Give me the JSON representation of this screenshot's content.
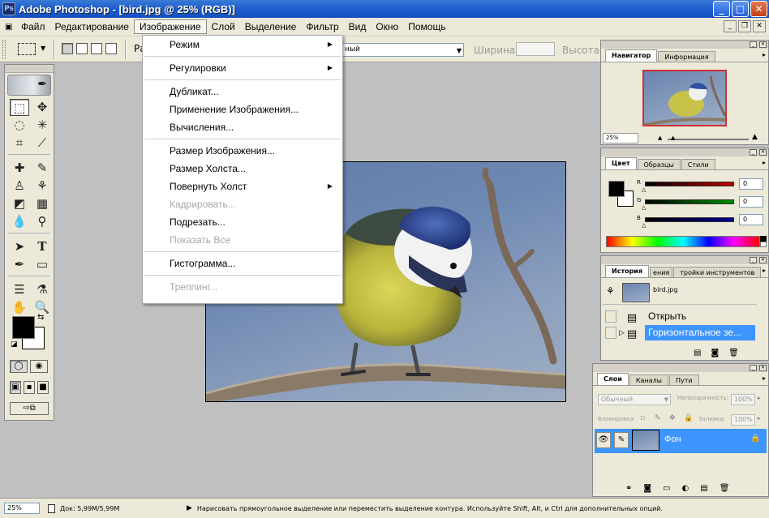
{
  "window": {
    "title": "Adobe Photoshop - [bird.jpg @ 25% (RGB)]",
    "minimize": "_",
    "maximize": "□",
    "close": "✕"
  },
  "mdi_buttons": {
    "minimize": "_",
    "restore": "❐",
    "close": "✕"
  },
  "menubar": {
    "items": [
      "Файл",
      "Редактирование",
      "Изображение",
      "Слой",
      "Выделение",
      "Фильтр",
      "Вид",
      "Окно",
      "Помощь"
    ],
    "active_index": 2
  },
  "options_bar": {
    "feather_prefix": "Ра",
    "style_value": "ный",
    "width_label": "Ширина:",
    "height_label": "Высота:"
  },
  "image_menu": {
    "groups": [
      [
        {
          "label": "Режим",
          "submenu": true,
          "disabled": false
        }
      ],
      [
        {
          "label": "Регулировки",
          "submenu": true,
          "disabled": false
        }
      ],
      [
        {
          "label": "Дубликат...",
          "submenu": false,
          "disabled": false
        },
        {
          "label": "Применение Изображения...",
          "submenu": false,
          "disabled": false
        },
        {
          "label": "Вычисления...",
          "submenu": false,
          "disabled": false
        }
      ],
      [
        {
          "label": "Размер Изображения...",
          "submenu": false,
          "disabled": false
        },
        {
          "label": "Размер Холста...",
          "submenu": false,
          "disabled": false
        },
        {
          "label": "Повернуть Холст",
          "submenu": true,
          "disabled": false
        },
        {
          "label": "Кадрировать...",
          "submenu": false,
          "disabled": true
        },
        {
          "label": "Подрезать...",
          "submenu": false,
          "disabled": false
        },
        {
          "label": "Показать Все",
          "submenu": false,
          "disabled": true
        }
      ],
      [
        {
          "label": "Гистограмма...",
          "submenu": false,
          "disabled": false
        }
      ],
      [
        {
          "label": "Треппинг...",
          "submenu": false,
          "disabled": true
        }
      ]
    ]
  },
  "navigator_palette": {
    "tabs": [
      "Навигатор",
      "Информация"
    ],
    "active_tab": 0,
    "zoom": "25%"
  },
  "color_palette": {
    "tabs": [
      "Цвет",
      "Образцы",
      "Стили"
    ],
    "active_tab": 0,
    "channels": [
      {
        "label": "R",
        "value": "0",
        "color": "#c00000"
      },
      {
        "label": "G",
        "value": "0",
        "color": "#009000"
      },
      {
        "label": "B",
        "value": "0",
        "color": "#000090"
      }
    ]
  },
  "history_palette": {
    "tabs": [
      "История",
      "ения",
      "тройки инструментов"
    ],
    "active_tab": 0,
    "snapshot": "bird.jpg",
    "items": [
      {
        "label": "Открыть",
        "selected": false
      },
      {
        "label": "Горизонтальное зе...",
        "selected": true
      }
    ]
  },
  "layers_palette": {
    "tabs": [
      "Слои",
      "Каналы",
      "Пути"
    ],
    "active_tab": 0,
    "blend_mode": "Обычный",
    "opacity_label": "Непрозрачность:",
    "opacity_value": "100%",
    "lock_label": "Блокировка:",
    "fill_label": "Заливка:",
    "fill_value": "100%",
    "layer_name": "Фон"
  },
  "status_bar": {
    "zoom": "25%",
    "doc_info": "Док: 5,99M/5,99M",
    "hint": "Нарисовать прямоугольное выделение или переместить выделение контура. Используйте Shift, Alt, и Ctrl для дополнительных опций."
  }
}
